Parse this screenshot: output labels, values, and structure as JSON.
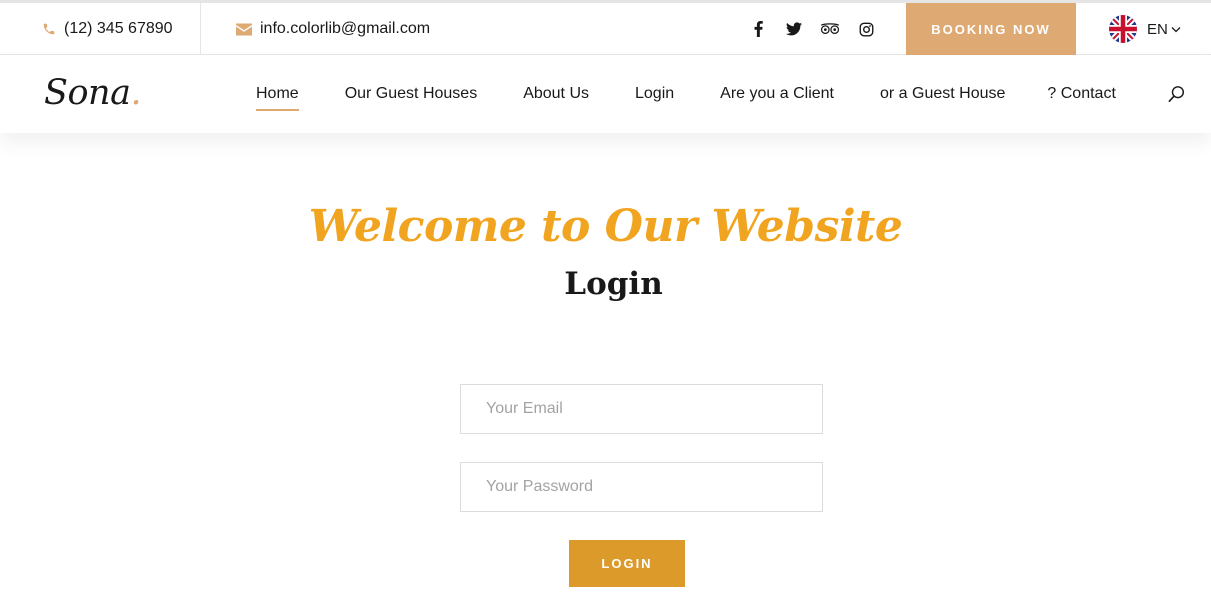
{
  "topbar": {
    "phone": "(12) 345 67890",
    "email": "info.colorlib@gmail.com",
    "social_icons": [
      "facebook-icon",
      "twitter-icon",
      "tripadvisor-icon",
      "instagram-icon"
    ],
    "booking_label": "BOOKING NOW",
    "language": "EN"
  },
  "nav": {
    "logo": "Sona",
    "logo_dot": ".",
    "items": [
      {
        "label": "Home",
        "active": true
      },
      {
        "label": "Our Guest Houses"
      },
      {
        "label": "About Us"
      },
      {
        "label": "Login"
      },
      {
        "label": "Are you a Client"
      },
      {
        "label": "or a Guest House"
      },
      {
        "label": "? Contact"
      }
    ]
  },
  "hero": {
    "title": "Welcome to Our Website",
    "subtitle": "Login"
  },
  "form": {
    "email_placeholder": "Your Email",
    "email_value": "",
    "password_placeholder": "Your Password",
    "password_value": "",
    "submit_label": "LOGIN"
  },
  "colors": {
    "accent": "#dfa974",
    "title_gold": "#f0a420",
    "login_button": "#dc9a2a"
  }
}
